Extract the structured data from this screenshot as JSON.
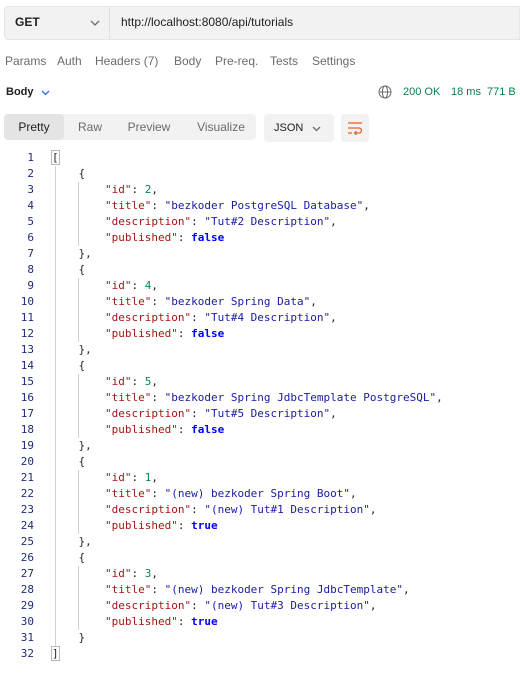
{
  "request": {
    "method": "GET",
    "url": "http://localhost:8080/api/tutorials"
  },
  "request_tabs": [
    {
      "label": "Params"
    },
    {
      "label": "Auth"
    },
    {
      "label": "Headers (7)"
    },
    {
      "label": "Body"
    },
    {
      "label": "Pre-req."
    },
    {
      "label": "Tests"
    },
    {
      "label": "Settings"
    }
  ],
  "response": {
    "section_label": "Body",
    "status": "200 OK",
    "time": "18 ms",
    "size": "771 B"
  },
  "view_tabs": [
    {
      "label": "Pretty",
      "active": true
    },
    {
      "label": "Raw",
      "active": false
    },
    {
      "label": "Preview",
      "active": false
    },
    {
      "label": "Visualize",
      "active": false
    }
  ],
  "format": {
    "selected": "JSON"
  },
  "tutorials": [
    {
      "id": "2",
      "title": "\"bezkoder PostgreSQL Database\"",
      "description": "\"Tut#2 Description\"",
      "published": "false"
    },
    {
      "id": "4",
      "title": "\"bezkoder Spring Data\"",
      "description": "\"Tut#4 Description\"",
      "published": "false"
    },
    {
      "id": "5",
      "title": "\"bezkoder Spring JdbcTemplate PostgreSQL\"",
      "description": "\"Tut#5 Description\"",
      "published": "false"
    },
    {
      "id": "1",
      "title": "\"(new) bezkoder Spring Boot\"",
      "description": "\"(new) Tut#1 Description\"",
      "published": "true"
    },
    {
      "id": "3",
      "title": "\"(new) bezkoder Spring JdbcTemplate\"",
      "description": "\"(new) Tut#3 Description\"",
      "published": "true"
    }
  ],
  "line_count": 32,
  "icons": {
    "method_dropdown": "chevron-down-icon",
    "body_dropdown": "chevron-down-icon",
    "network": "globe-icon",
    "format_dropdown": "chevron-down-icon",
    "wrap": "wrap-lines-icon"
  },
  "colors": {
    "key": "#a31515",
    "string": "#1a1aa6",
    "number": "#098658",
    "boolean": "#0000ff",
    "status": "#0a7f49",
    "wrap_icon": "#e8642a"
  }
}
